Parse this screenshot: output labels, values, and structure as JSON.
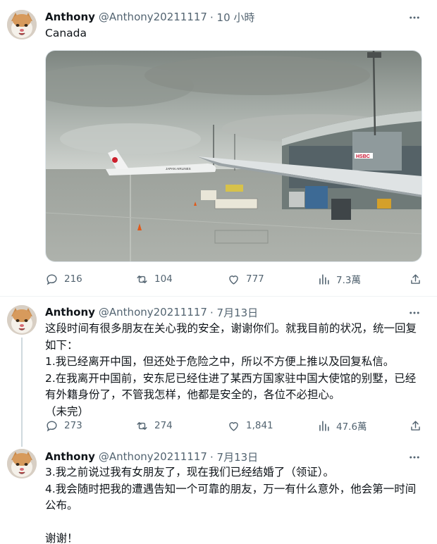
{
  "tweets": [
    {
      "name": "Anthony",
      "handle": "@Anthony20211117",
      "time": "· 10 小時",
      "text": "Canada",
      "stats": {
        "replies": "216",
        "retweets": "104",
        "likes": "777",
        "views": "7.3萬"
      }
    },
    {
      "name": "Anthony",
      "handle": "@Anthony20211117",
      "time": "· 7月13日",
      "text": "这段时间有很多朋友在关心我的安全，谢谢你们。就我目前的状况，统一回复如下：\n1.我已经离开中国，但还处于危险之中，所以不方便上推以及回复私信。\n2.在我离开中国前，安东尼已经住进了某西方国家驻中国大使馆的别墅，已经有外籍身份了，不管我怎样，他都是安全的，各位不必担心。\n（未完）",
      "stats": {
        "replies": "273",
        "retweets": "274",
        "likes": "1,841",
        "views": "47.6萬"
      }
    },
    {
      "name": "Anthony",
      "handle": "@Anthony20211117",
      "time": "· 7月13日",
      "text": "3.我之前说过我有女朋友了，现在我们已经结婚了（领证）。\n4.我会随时把我的遭遇告知一个可靠的朋友，万一有什么意外，他会第一时间公布。\n\n谢谢！"
    }
  ],
  "media": {
    "airline_text": "JAPAN AIRLINES",
    "bank_sign": "HSBC"
  },
  "colors": {
    "text": "#0f1419",
    "muted": "#536471",
    "divider": "#eff3f4",
    "thread": "#cfd9de"
  }
}
